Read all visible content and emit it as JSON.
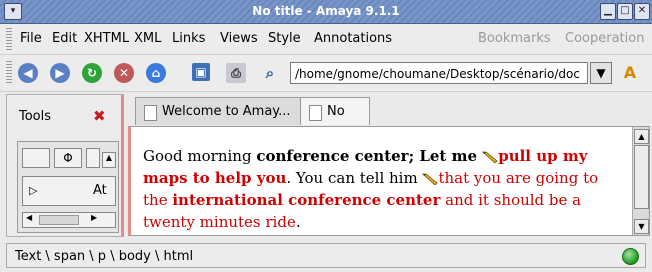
{
  "window": {
    "title": "No title - Amaya 9.1.1"
  },
  "menubar": {
    "items": [
      {
        "label": "File",
        "enabled": true
      },
      {
        "label": "Edit",
        "enabled": true
      },
      {
        "label": "XHTML",
        "enabled": true
      },
      {
        "label": "XML",
        "enabled": true
      },
      {
        "label": "Links",
        "enabled": true
      },
      {
        "label": "Views",
        "enabled": true
      },
      {
        "label": "Style",
        "enabled": true
      },
      {
        "label": "Annotations",
        "enabled": true
      },
      {
        "label": "Bookmarks",
        "enabled": false
      },
      {
        "label": "Cooperation",
        "enabled": false
      }
    ]
  },
  "toolbar": {
    "url": "/home/gnome/choumane/Desktop/scénario/doc",
    "icons": [
      "back-icon",
      "forward-icon",
      "reload-icon",
      "stop-icon",
      "home-icon",
      "save-icon",
      "print-icon",
      "find-icon"
    ]
  },
  "tools": {
    "title": "Tools",
    "item_label": "At"
  },
  "tabs": [
    {
      "label": "Welcome to Amay..."
    },
    {
      "label": "No title"
    }
  ],
  "content": {
    "segments": [
      {
        "text": "Good morning ",
        "style": "normal"
      },
      {
        "text": "conference center; Let me ",
        "style": "bold"
      },
      {
        "text": "pull up my maps to help you",
        "style": "bold-red",
        "pencil": true
      },
      {
        "text": ". You can tell him ",
        "style": "normal"
      },
      {
        "text": "that you are going to the ",
        "style": "red",
        "pencil": true
      },
      {
        "text": "international conference center",
        "style": "bold-red"
      },
      {
        "text": " and it should be a twenty minutes ride",
        "style": "red"
      },
      {
        "text": ".",
        "style": "normal"
      }
    ]
  },
  "status": {
    "path": "Text \\ span \\ p \\ body \\ html"
  },
  "colors": {
    "accent_red": "#d00000",
    "title_bar": "#7895c8"
  }
}
